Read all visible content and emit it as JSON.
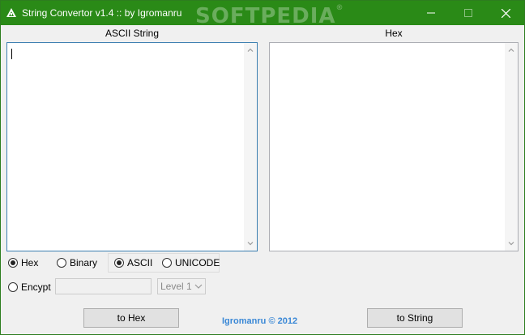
{
  "window": {
    "title": "String Convertor v1.4 :: by Igromanru",
    "watermark": "SOFTPEDIA",
    "watermark_mark": "®"
  },
  "panes": {
    "left_label": "ASCII String",
    "left_text": "",
    "right_label": "Hex",
    "right_text": ""
  },
  "output_format": {
    "options": [
      "Hex",
      "Binary"
    ],
    "selected": "Hex"
  },
  "encoding": {
    "options": [
      "ASCII",
      "UNICODE"
    ],
    "selected": "ASCII"
  },
  "encrypt": {
    "label": "Encypt",
    "checked": false,
    "key_value": "",
    "level_value": "Level 1"
  },
  "buttons": {
    "to_hex": "to Hex",
    "to_string": "to String"
  },
  "credit": "Igromanru © 2012",
  "colors": {
    "titlebar": "#2a8a17",
    "credit": "#3a88d6"
  }
}
